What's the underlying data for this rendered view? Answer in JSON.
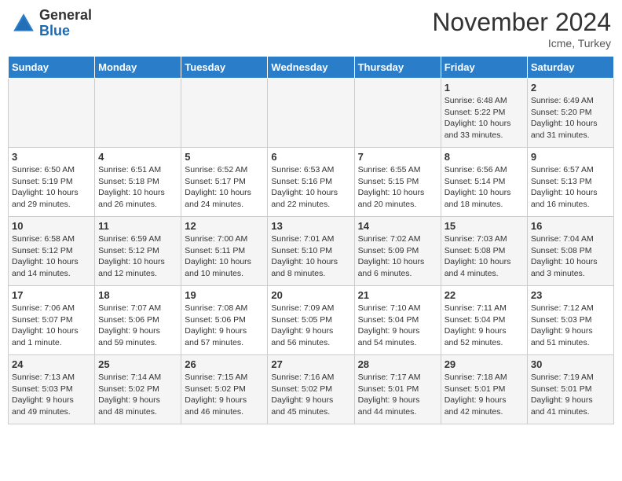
{
  "logo": {
    "general": "General",
    "blue": "Blue"
  },
  "title": "November 2024",
  "subtitle": "Icme, Turkey",
  "weekdays": [
    "Sunday",
    "Monday",
    "Tuesday",
    "Wednesday",
    "Thursday",
    "Friday",
    "Saturday"
  ],
  "weeks": [
    [
      {
        "day": "",
        "info": ""
      },
      {
        "day": "",
        "info": ""
      },
      {
        "day": "",
        "info": ""
      },
      {
        "day": "",
        "info": ""
      },
      {
        "day": "",
        "info": ""
      },
      {
        "day": "1",
        "info": "Sunrise: 6:48 AM\nSunset: 5:22 PM\nDaylight: 10 hours\nand 33 minutes."
      },
      {
        "day": "2",
        "info": "Sunrise: 6:49 AM\nSunset: 5:20 PM\nDaylight: 10 hours\nand 31 minutes."
      }
    ],
    [
      {
        "day": "3",
        "info": "Sunrise: 6:50 AM\nSunset: 5:19 PM\nDaylight: 10 hours\nand 29 minutes."
      },
      {
        "day": "4",
        "info": "Sunrise: 6:51 AM\nSunset: 5:18 PM\nDaylight: 10 hours\nand 26 minutes."
      },
      {
        "day": "5",
        "info": "Sunrise: 6:52 AM\nSunset: 5:17 PM\nDaylight: 10 hours\nand 24 minutes."
      },
      {
        "day": "6",
        "info": "Sunrise: 6:53 AM\nSunset: 5:16 PM\nDaylight: 10 hours\nand 22 minutes."
      },
      {
        "day": "7",
        "info": "Sunrise: 6:55 AM\nSunset: 5:15 PM\nDaylight: 10 hours\nand 20 minutes."
      },
      {
        "day": "8",
        "info": "Sunrise: 6:56 AM\nSunset: 5:14 PM\nDaylight: 10 hours\nand 18 minutes."
      },
      {
        "day": "9",
        "info": "Sunrise: 6:57 AM\nSunset: 5:13 PM\nDaylight: 10 hours\nand 16 minutes."
      }
    ],
    [
      {
        "day": "10",
        "info": "Sunrise: 6:58 AM\nSunset: 5:12 PM\nDaylight: 10 hours\nand 14 minutes."
      },
      {
        "day": "11",
        "info": "Sunrise: 6:59 AM\nSunset: 5:12 PM\nDaylight: 10 hours\nand 12 minutes."
      },
      {
        "day": "12",
        "info": "Sunrise: 7:00 AM\nSunset: 5:11 PM\nDaylight: 10 hours\nand 10 minutes."
      },
      {
        "day": "13",
        "info": "Sunrise: 7:01 AM\nSunset: 5:10 PM\nDaylight: 10 hours\nand 8 minutes."
      },
      {
        "day": "14",
        "info": "Sunrise: 7:02 AM\nSunset: 5:09 PM\nDaylight: 10 hours\nand 6 minutes."
      },
      {
        "day": "15",
        "info": "Sunrise: 7:03 AM\nSunset: 5:08 PM\nDaylight: 10 hours\nand 4 minutes."
      },
      {
        "day": "16",
        "info": "Sunrise: 7:04 AM\nSunset: 5:08 PM\nDaylight: 10 hours\nand 3 minutes."
      }
    ],
    [
      {
        "day": "17",
        "info": "Sunrise: 7:06 AM\nSunset: 5:07 PM\nDaylight: 10 hours\nand 1 minute."
      },
      {
        "day": "18",
        "info": "Sunrise: 7:07 AM\nSunset: 5:06 PM\nDaylight: 9 hours\nand 59 minutes."
      },
      {
        "day": "19",
        "info": "Sunrise: 7:08 AM\nSunset: 5:06 PM\nDaylight: 9 hours\nand 57 minutes."
      },
      {
        "day": "20",
        "info": "Sunrise: 7:09 AM\nSunset: 5:05 PM\nDaylight: 9 hours\nand 56 minutes."
      },
      {
        "day": "21",
        "info": "Sunrise: 7:10 AM\nSunset: 5:04 PM\nDaylight: 9 hours\nand 54 minutes."
      },
      {
        "day": "22",
        "info": "Sunrise: 7:11 AM\nSunset: 5:04 PM\nDaylight: 9 hours\nand 52 minutes."
      },
      {
        "day": "23",
        "info": "Sunrise: 7:12 AM\nSunset: 5:03 PM\nDaylight: 9 hours\nand 51 minutes."
      }
    ],
    [
      {
        "day": "24",
        "info": "Sunrise: 7:13 AM\nSunset: 5:03 PM\nDaylight: 9 hours\nand 49 minutes."
      },
      {
        "day": "25",
        "info": "Sunrise: 7:14 AM\nSunset: 5:02 PM\nDaylight: 9 hours\nand 48 minutes."
      },
      {
        "day": "26",
        "info": "Sunrise: 7:15 AM\nSunset: 5:02 PM\nDaylight: 9 hours\nand 46 minutes."
      },
      {
        "day": "27",
        "info": "Sunrise: 7:16 AM\nSunset: 5:02 PM\nDaylight: 9 hours\nand 45 minutes."
      },
      {
        "day": "28",
        "info": "Sunrise: 7:17 AM\nSunset: 5:01 PM\nDaylight: 9 hours\nand 44 minutes."
      },
      {
        "day": "29",
        "info": "Sunrise: 7:18 AM\nSunset: 5:01 PM\nDaylight: 9 hours\nand 42 minutes."
      },
      {
        "day": "30",
        "info": "Sunrise: 7:19 AM\nSunset: 5:01 PM\nDaylight: 9 hours\nand 41 minutes."
      }
    ]
  ]
}
